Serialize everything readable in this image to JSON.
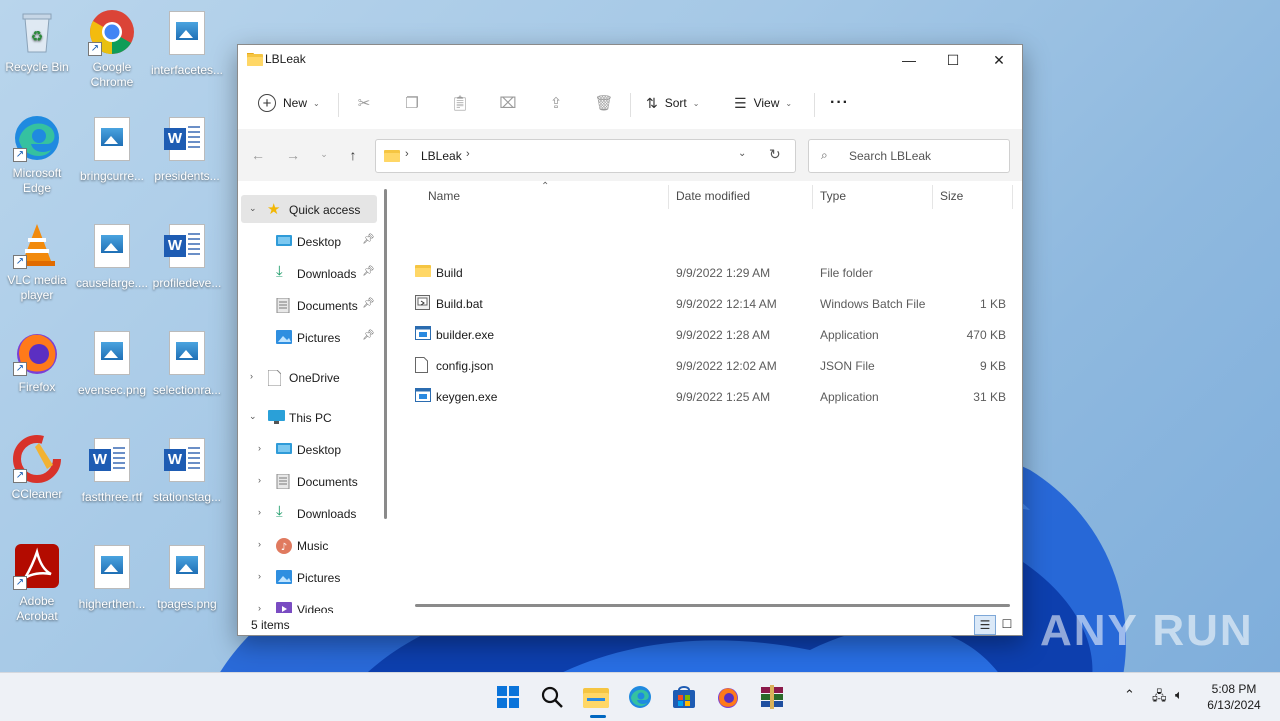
{
  "desktop": {
    "icons": [
      {
        "label": "Recycle Bin"
      },
      {
        "label": "Google Chrome"
      },
      {
        "label": "interfacetes..."
      },
      {
        "label": "Microsoft Edge"
      },
      {
        "label": "bringcurre..."
      },
      {
        "label": "presidents..."
      },
      {
        "label": "VLC media player"
      },
      {
        "label": "causelarge...."
      },
      {
        "label": "profiledeve..."
      },
      {
        "label": "Firefox"
      },
      {
        "label": "evensec.png"
      },
      {
        "label": "selectionra..."
      },
      {
        "label": "CCleaner"
      },
      {
        "label": "fastthree.rtf"
      },
      {
        "label": "stationstag..."
      },
      {
        "label": "Adobe Acrobat"
      },
      {
        "label": "higherthen..."
      },
      {
        "label": "tpages.png"
      }
    ]
  },
  "window": {
    "title": "LBLeak",
    "controls": {
      "minimize": "—",
      "maximize": "☐",
      "close": "✕"
    }
  },
  "toolbar": {
    "new_label": "New",
    "sort_label": "Sort",
    "view_label": "View",
    "more_label": "···"
  },
  "address": {
    "crumb": "LBLeak",
    "separator": "›"
  },
  "search": {
    "placeholder": "Search LBLeak"
  },
  "nav_pane": {
    "quick_access": "Quick access",
    "quick_items": [
      {
        "label": "Desktop"
      },
      {
        "label": "Downloads"
      },
      {
        "label": "Documents"
      },
      {
        "label": "Pictures"
      }
    ],
    "onedrive": "OneDrive",
    "this_pc": "This PC",
    "pc_items": [
      {
        "label": "Desktop"
      },
      {
        "label": "Documents"
      },
      {
        "label": "Downloads"
      },
      {
        "label": "Music"
      },
      {
        "label": "Pictures"
      },
      {
        "label": "Videos"
      }
    ]
  },
  "columns": {
    "name": "Name",
    "date": "Date modified",
    "type": "Type",
    "size": "Size"
  },
  "files": [
    {
      "name": "Build",
      "date": "9/9/2022 1:29 AM",
      "type": "File folder",
      "size": "",
      "icon": "folder-icon"
    },
    {
      "name": "Build.bat",
      "date": "9/9/2022 12:14 AM",
      "type": "Windows Batch File",
      "size": "1 KB",
      "icon": "batch-file-icon"
    },
    {
      "name": "builder.exe",
      "date": "9/9/2022 1:28 AM",
      "type": "Application",
      "size": "470 KB",
      "icon": "application-icon"
    },
    {
      "name": "config.json",
      "date": "9/9/2022 12:02 AM",
      "type": "JSON File",
      "size": "9 KB",
      "icon": "json-file-icon"
    },
    {
      "name": "keygen.exe",
      "date": "9/9/2022 1:25 AM",
      "type": "Application",
      "size": "31 KB",
      "icon": "application-icon"
    }
  ],
  "status": {
    "items_count": "5 items"
  },
  "taskbar": {
    "time": "5:08 PM",
    "date": "6/13/2024"
  },
  "watermark": "ANY RUN",
  "colors": {
    "accent": "#0067c0",
    "folder": "#f5c542",
    "selection": "#e5e5e5"
  }
}
